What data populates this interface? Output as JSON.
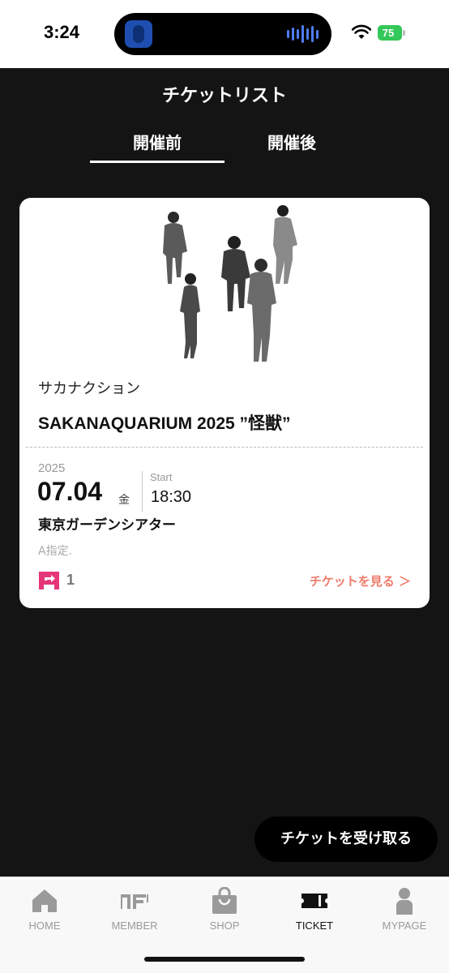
{
  "status_bar": {
    "time": "3:24",
    "battery": "75"
  },
  "header": {
    "title": "チケットリスト"
  },
  "tabs": [
    {
      "label": "開催前",
      "active": true
    },
    {
      "label": "開催後",
      "active": false
    }
  ],
  "ticket_card": {
    "artist": "サカナクション",
    "event_title": "SAKANAQUARIUM 2025 ”怪獣”",
    "year": "2025",
    "date": "07.04",
    "weekday": "金",
    "start_label": "Start",
    "start_time": "18:30",
    "venue": "東京ガーデンシアター",
    "seat": "A指定.",
    "ticket_count": "1",
    "view_link": "チケットを見る ＞",
    "accent_color": "#ef7a6a",
    "icon_color": "#e6367a"
  },
  "receive_button": {
    "label": "チケットを受け取る"
  },
  "bottom_nav": {
    "items": [
      {
        "label": "HOME",
        "icon": "home-icon"
      },
      {
        "label": "MEMBER",
        "icon": "member-logo-icon"
      },
      {
        "label": "SHOP",
        "icon": "shopping-bag-icon"
      },
      {
        "label": "TICKET",
        "icon": "ticket-icon",
        "active": true
      },
      {
        "label": "MYPAGE",
        "icon": "person-icon"
      }
    ]
  }
}
